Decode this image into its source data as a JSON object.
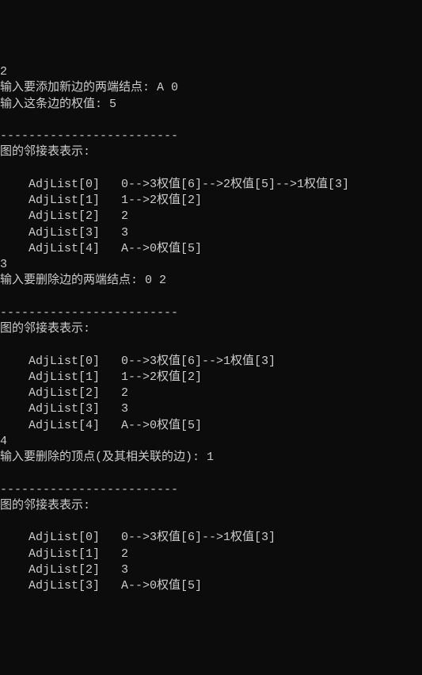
{
  "terminal": {
    "lines": [
      "2",
      "输入要添加新边的两端结点: A 0",
      "输入这条边的权值: 5",
      "",
      "-------------------------",
      "图的邻接表表示:",
      "",
      "    AdjList[0]   0-->3权值[6]-->2权值[5]-->1权值[3]",
      "    AdjList[1]   1-->2权值[2]",
      "    AdjList[2]   2",
      "    AdjList[3]   3",
      "    AdjList[4]   A-->0权值[5]",
      "3",
      "输入要删除边的两端结点: 0 2",
      "",
      "-------------------------",
      "图的邻接表表示:",
      "",
      "    AdjList[0]   0-->3权值[6]-->1权值[3]",
      "    AdjList[1]   1-->2权值[2]",
      "    AdjList[2]   2",
      "    AdjList[3]   3",
      "    AdjList[4]   A-->0权值[5]",
      "4",
      "输入要删除的顶点(及其相关联的边): 1",
      "",
      "-------------------------",
      "图的邻接表表示:",
      "",
      "    AdjList[0]   0-->3权值[6]-->1权值[3]",
      "    AdjList[1]   2",
      "    AdjList[2]   3",
      "    AdjList[3]   A-->0权值[5]"
    ]
  }
}
